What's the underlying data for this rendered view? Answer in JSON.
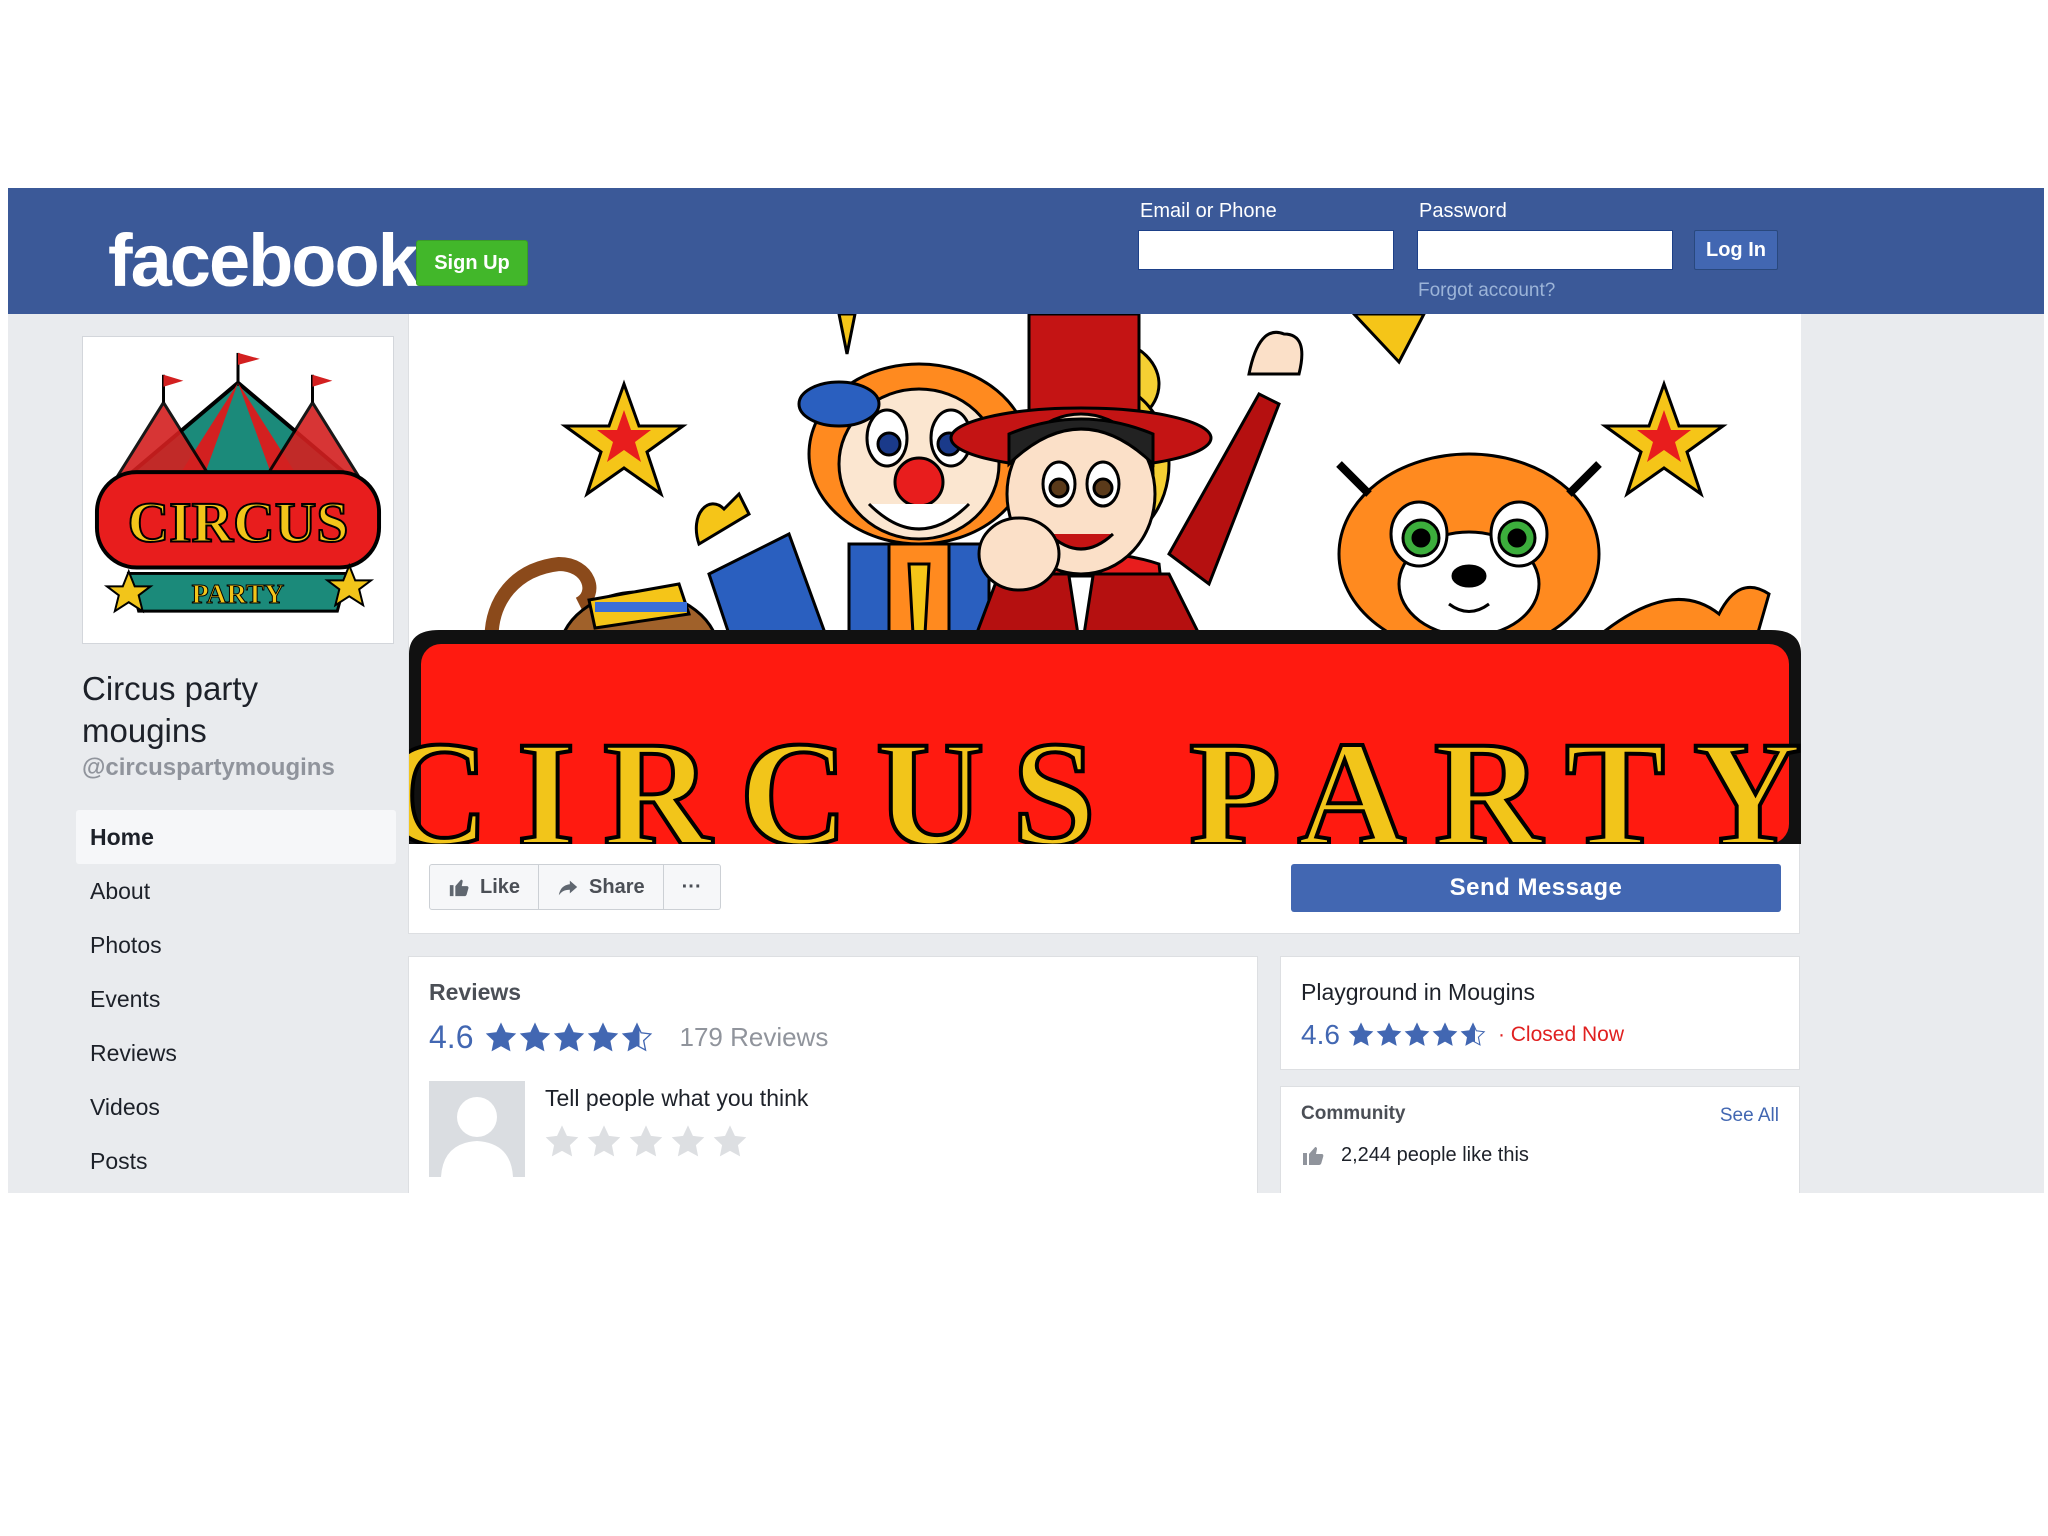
{
  "header": {
    "logo_text": "facebook",
    "signup_label": "Sign Up",
    "email_label": "Email or Phone",
    "email_value": "",
    "password_label": "Password",
    "password_value": "",
    "login_label": "Log In",
    "forgot_label": "Forgot account?"
  },
  "page": {
    "profile_picture_text": [
      "CIRCUS",
      "PARTY"
    ],
    "name": "Circus party mougins",
    "handle": "@circuspartymougins",
    "cover_banner_text": "CIRCUS PARTY"
  },
  "nav": {
    "items": [
      {
        "label": "Home",
        "active": true
      },
      {
        "label": "About",
        "active": false
      },
      {
        "label": "Photos",
        "active": false
      },
      {
        "label": "Events",
        "active": false
      },
      {
        "label": "Reviews",
        "active": false
      },
      {
        "label": "Videos",
        "active": false
      },
      {
        "label": "Posts",
        "active": false
      }
    ]
  },
  "actions": {
    "like_label": "Like",
    "share_label": "Share",
    "more_label": "···",
    "send_message_label": "Send Message"
  },
  "reviews": {
    "title": "Reviews",
    "rating": "4.6",
    "rating_stars": 4.6,
    "count_label": "179 Reviews",
    "prompt": "Tell people what you think"
  },
  "place": {
    "title": "Playground in Mougins",
    "rating": "4.6",
    "rating_stars": 4.6,
    "status": "· Closed Now"
  },
  "community": {
    "title": "Community",
    "see_all_label": "See All",
    "likes_label": "2,244 people like this"
  },
  "colors": {
    "brand_blue": "#3b5998",
    "button_blue": "#4267b2",
    "signup_green": "#42b72a",
    "star_blue": "#4267b2",
    "closed_red": "#e02020"
  },
  "icons": [
    "thumbs-up-icon",
    "share-arrow-icon",
    "more-dots-icon",
    "star-icon",
    "avatar-silhouette-icon"
  ]
}
